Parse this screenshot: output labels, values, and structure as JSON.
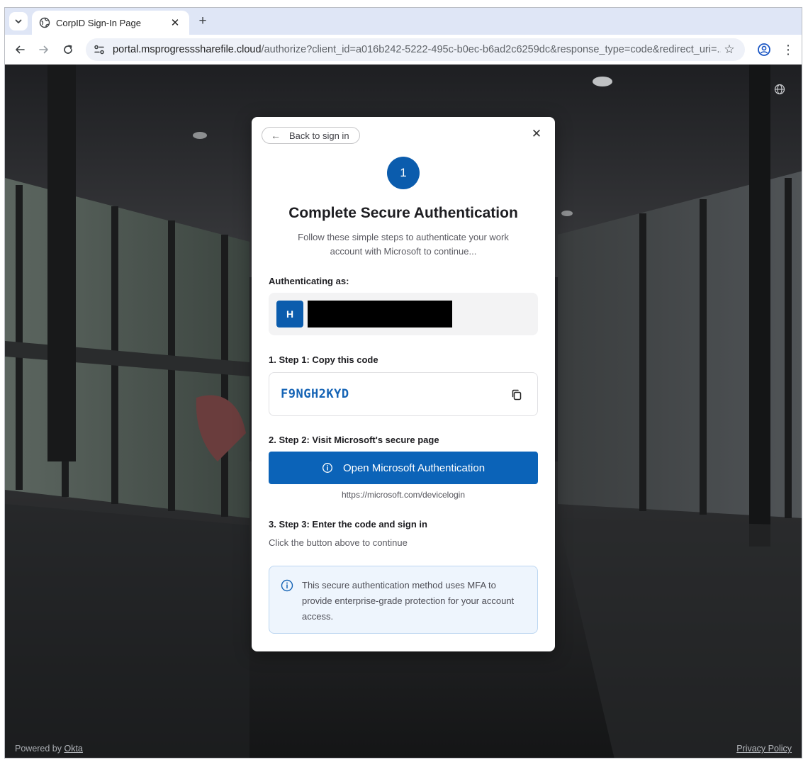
{
  "browser": {
    "tab_title": "CorpID Sign-In Page",
    "tab_close": "✕",
    "new_tab": "+",
    "url_host": "portal.msprogresssharefile.cloud",
    "url_rest": "/authorize?client_id=a016b242-5222-495c-b0ec-b6ad2c6259dc&response_type=code&redirect_uri=..."
  },
  "card": {
    "back_label": "Back to sign in",
    "step_number": "1",
    "title": "Complete Secure Authentication",
    "subtitle": "Follow these simple steps to authenticate your work account with Microsoft to continue...",
    "authenticating_label": "Authenticating as:",
    "user_initial": "H",
    "step1_label": "1. Step 1: Copy this code",
    "code": "F9NGH2KYD",
    "step2_label": "2. Step 2: Visit Microsoft's secure page",
    "open_button_label": "Open Microsoft Authentication",
    "helper_url": "https://microsoft.com/devicelogin",
    "step3_label": "3. Step 3: Enter the code and sign in",
    "step3_text": "Click the button above to continue",
    "info_text": "This secure authentication method uses MFA to provide enterprise-grade protection for your account access."
  },
  "footer": {
    "powered_prefix": "Powered by ",
    "powered_link": "Okta",
    "privacy": "Privacy Policy"
  },
  "colors": {
    "accent": "#0b63b8",
    "code_text": "#1463b5",
    "info_bg": "#eef5fd"
  }
}
